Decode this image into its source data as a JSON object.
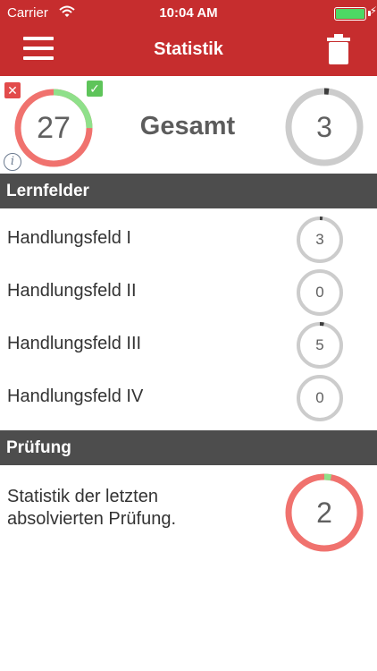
{
  "status_bar": {
    "carrier": "Carrier",
    "time": "10:04 AM"
  },
  "nav": {
    "title": "Statistik",
    "menu_icon": "hamburger-menu-icon",
    "trash_icon": "trash-icon"
  },
  "summary": {
    "correct_wrong_total": "27",
    "correct_fraction": 0.25,
    "label": "Gesamt",
    "learned_total": "3",
    "learned_fraction": 0.02,
    "wrong_badge": "✕",
    "right_badge": "✓",
    "info": "i"
  },
  "sections": {
    "lernfelder": "Lernfelder",
    "pruefung": "Prüfung"
  },
  "lernfelder": [
    {
      "label": "Handlungsfeld I",
      "value": "3",
      "fraction": 0.02
    },
    {
      "label": "Handlungsfeld II",
      "value": "0",
      "fraction": 0
    },
    {
      "label": "Handlungsfeld III",
      "value": "5",
      "fraction": 0.03
    },
    {
      "label": "Handlungsfeld IV",
      "value": "0",
      "fraction": 0
    }
  ],
  "exam": {
    "text": "Statistik der letzten absolvierten Prüfung.",
    "value": "2",
    "correct_fraction": 0.03
  },
  "colors": {
    "header": "#c62d2e",
    "section": "#4d4d4d",
    "correct": "#8fe08a",
    "wrong": "#f0726e",
    "progress_gray": "#cccccc",
    "progress_dark": "#3d3d3d"
  }
}
